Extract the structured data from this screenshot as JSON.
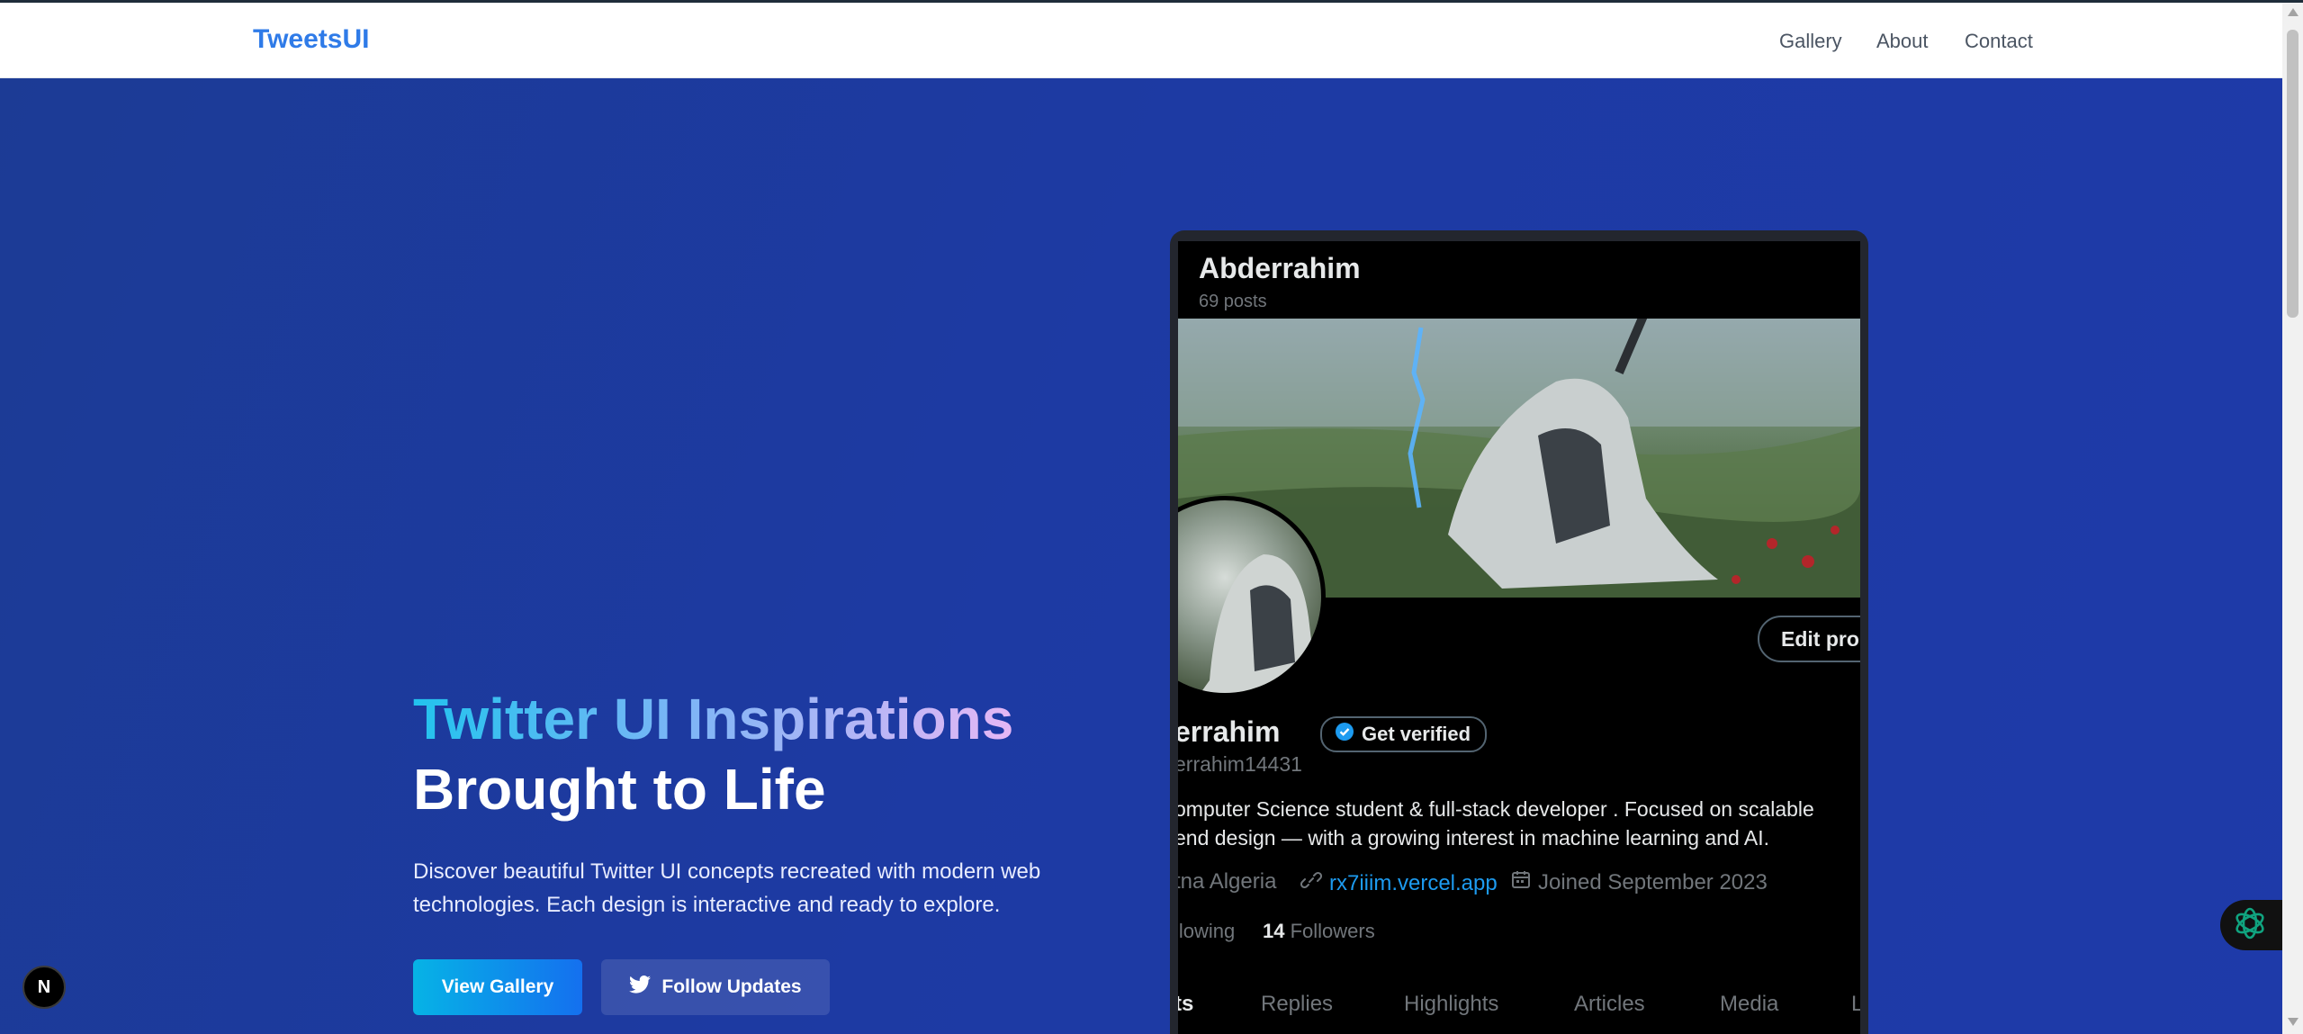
{
  "navbar": {
    "brand": "TweetsUI",
    "links": [
      "Gallery",
      "About",
      "Contact"
    ]
  },
  "hero": {
    "title_line1": "Twitter UI Inspirations",
    "title_line2": "Brought to Life",
    "description": "Discover beautiful Twitter UI concepts recreated with modern web technologies. Each design is interactive and ready to explore.",
    "primary_button": "View Gallery",
    "secondary_button": "Follow Updates"
  },
  "profile_preview": {
    "header_name": "Abderrahim",
    "post_count": "69 posts",
    "edit_button": "Edit pro",
    "display_name": "errahim",
    "verified_label": "Get verified",
    "handle": "errahim14431",
    "bio_line1": "omputer Science student & full-stack developer . Focused on scalable",
    "bio_line2": "end design — with a growing  interest in machine learning and AI.",
    "location": "tna Algeria",
    "website": "rx7iiim.vercel.app",
    "joined": "Joined September 2023",
    "following_label": "llowing",
    "followers_count": "14",
    "followers_label": "Followers",
    "tabs": [
      "ts",
      "Replies",
      "Highlights",
      "Articles",
      "Media",
      "L"
    ]
  },
  "widgets": {
    "next_badge": "N"
  },
  "colors": {
    "brand": "#2f7be8",
    "hero_bg": "#1e3aa0",
    "twitter_blue": "#1d9bf0",
    "ai_widget": "#10a37f"
  }
}
